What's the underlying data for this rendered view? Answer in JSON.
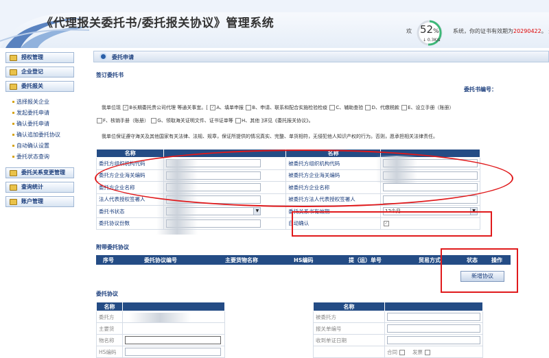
{
  "header": {
    "title": "《代理报关委托书/委托报关协议》管理系统",
    "notice_prefix": "欢",
    "notice_mid": "系统，你的证书有效期为",
    "notice_date": "20290422",
    "notice_suffix": "。 退",
    "perf_percent": "52",
    "perf_unit": "%",
    "perf_rate": "↓ 0.3K/s"
  },
  "sidebar": {
    "items": [
      {
        "label": "授权管理"
      },
      {
        "label": "企业登记"
      },
      {
        "label": "委托报关"
      },
      {
        "label": "委托关系变更管理"
      },
      {
        "label": "查询统计"
      },
      {
        "label": "账户管理"
      }
    ],
    "subitems": [
      {
        "label": "选择报关企业"
      },
      {
        "label": "发起委托申请"
      },
      {
        "label": "确认委托申请"
      },
      {
        "label": "确认追加委托协议"
      },
      {
        "label": "自动确认设置"
      },
      {
        "label": "委托状态查询"
      }
    ]
  },
  "main": {
    "section_title": "委托申请",
    "sign_title": "签订委托书",
    "doc_no_label": "委托书编号：",
    "para1_a": "我单位现",
    "para1_b": "B长期",
    "para1_c": "委托贵公司代理 等通关事宜。[",
    "opt_a": "A、填单申报",
    "opt_b": "B、申请、联系和配合实施检验检疫",
    "opt_c": "C、辅助查验",
    "opt_d": "D、代缴税款",
    "opt_e": "E、设立手册（账册）",
    "opt_f": "F、核销手册（账册）",
    "opt_g": "G、领取海关证明文件、证书证单等",
    "opt_h": "H、其他 ]详见《委托报关协议》。",
    "para2": "我单位保证遵守海关及其他国家有关法律、法规、规章，保证所提供的情况真实、完整、单货相符，无侵犯他人知识产权的行为。否则，愿承担相关法律责任。",
    "left_header": "名称",
    "right_header": "名称",
    "left_rows": [
      {
        "label": "委托方组织机构代码"
      },
      {
        "label": "委托方企业海关编码"
      },
      {
        "label": "委托方企业名称"
      },
      {
        "label": "法人代表授权签署人"
      },
      {
        "label": "委托书状态"
      },
      {
        "label": "委托协议份数"
      }
    ],
    "right_rows": [
      {
        "label": "被委托方组织机构代码"
      },
      {
        "label": "被委托方企业海关编码"
      },
      {
        "label": "被委托方企业名称"
      },
      {
        "label": "被委托方法人代表授权签署人"
      },
      {
        "label": "委托关系书有效期"
      },
      {
        "label": "自动确认"
      }
    ],
    "validity_value": "12个月",
    "attach_title": "附带委托协议",
    "attach_cols": [
      "序号",
      "委托协议编号",
      "主要货物名称",
      "HS编码",
      "提（运）单号",
      "贸易方式",
      "状态",
      "操作"
    ],
    "add_button": "新增协议",
    "agreement_title": "委托协议",
    "agreement_left_header": "名称",
    "agreement_right_header": "名称",
    "agreement_left_rows": [
      "委托方",
      "主要货",
      "物名称",
      "HS编码"
    ],
    "agreement_right_rows": [
      "被委托方",
      "报关单编号",
      "收到单证日期",
      ""
    ],
    "agreement_right_bottom": [
      "合同",
      "发票"
    ]
  }
}
